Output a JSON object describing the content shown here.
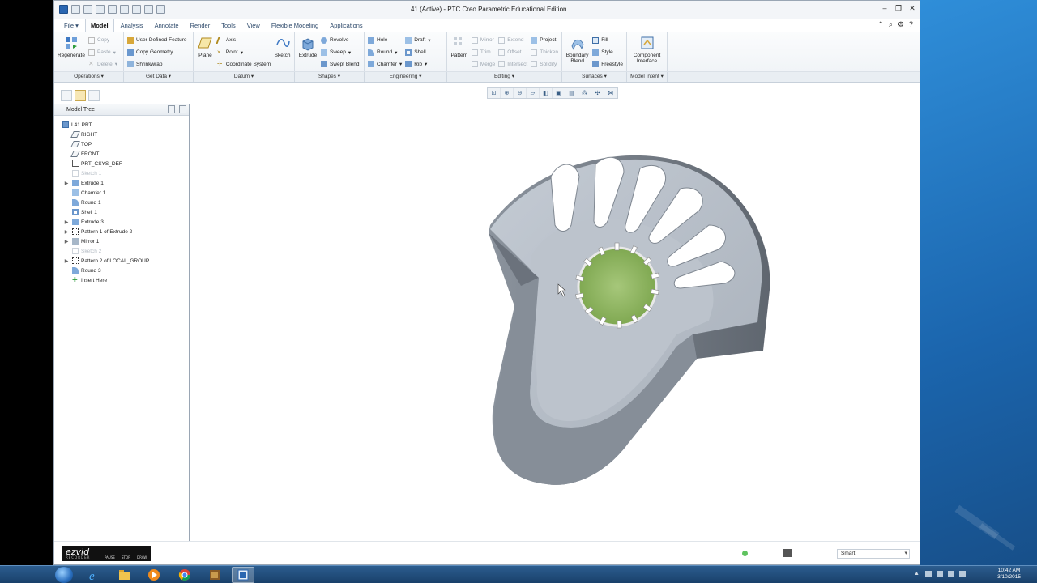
{
  "window": {
    "title": "L41 (Active) - PTC Creo Parametric Educational Edition"
  },
  "menu": {
    "tabs": [
      "File",
      "Model",
      "Analysis",
      "Annotate",
      "Render",
      "Tools",
      "View",
      "Flexible Modeling",
      "Applications"
    ],
    "active_tab": "Model"
  },
  "ribbon": {
    "operations": {
      "regenerate": "Regenerate",
      "copy": "Copy",
      "paste": "Paste",
      "delete": "Delete",
      "label": "Operations"
    },
    "get_data": {
      "udf": "User-Defined Feature",
      "copy_geometry": "Copy Geometry",
      "shrinkwrap": "Shrinkwrap",
      "label": "Get Data"
    },
    "datum": {
      "plane": "Plane",
      "axis": "Axis",
      "point": "Point",
      "csys": "Coordinate System",
      "sketch": "Sketch",
      "label": "Datum"
    },
    "shapes": {
      "extrude": "Extrude",
      "revolve": "Revolve",
      "sweep": "Sweep",
      "swept_blend": "Swept Blend",
      "label": "Shapes"
    },
    "engineering": {
      "hole": "Hole",
      "round": "Round",
      "chamfer": "Chamfer",
      "draft": "Draft",
      "shell": "Shell",
      "rib": "Rib",
      "label": "Engineering"
    },
    "editing": {
      "pattern": "Pattern",
      "mirror": "Mirror",
      "trim": "Trim",
      "merge": "Merge",
      "extend": "Extend",
      "offset": "Offset",
      "intersect": "Intersect",
      "project": "Project",
      "thicken": "Thicken",
      "solidify": "Solidify",
      "label": "Editing"
    },
    "surfaces": {
      "boundary_blend_1": "Boundary",
      "boundary_blend_2": "Blend",
      "fill": "Fill",
      "style": "Style",
      "freestyle": "Freestyle",
      "label": "Surfaces"
    },
    "model_intent": {
      "component_interface_1": "Component",
      "component_interface_2": "Interface",
      "label": "Model Intent"
    }
  },
  "model_tree": {
    "header": "Model Tree",
    "items": [
      {
        "label": "L41.PRT",
        "icon": "part-icon",
        "dim": false,
        "expand": false,
        "indent": 0
      },
      {
        "label": "RIGHT",
        "icon": "datum-plane-icon",
        "dim": false,
        "expand": false,
        "indent": 1
      },
      {
        "label": "TOP",
        "icon": "datum-plane-icon",
        "dim": false,
        "expand": false,
        "indent": 1
      },
      {
        "label": "FRONT",
        "icon": "datum-plane-icon",
        "dim": false,
        "expand": false,
        "indent": 1
      },
      {
        "label": "PRT_CSYS_DEF",
        "icon": "csys-icon",
        "dim": false,
        "expand": false,
        "indent": 1
      },
      {
        "label": "Sketch 1",
        "icon": "sketch-icon",
        "dim": true,
        "expand": false,
        "indent": 1
      },
      {
        "label": "Extrude 1",
        "icon": "extrude-icon",
        "dim": false,
        "expand": true,
        "indent": 1
      },
      {
        "label": "Chamfer 1",
        "icon": "chamfer-icon",
        "dim": false,
        "expand": false,
        "indent": 1
      },
      {
        "label": "Round 1",
        "icon": "round-icon",
        "dim": false,
        "expand": false,
        "indent": 1
      },
      {
        "label": "Shell 1",
        "icon": "shell-icon",
        "dim": false,
        "expand": false,
        "indent": 1
      },
      {
        "label": "Extrude 3",
        "icon": "extrude-icon",
        "dim": false,
        "expand": true,
        "indent": 1
      },
      {
        "label": "Pattern 1 of Extrude 2",
        "icon": "pattern-icon",
        "dim": false,
        "expand": true,
        "indent": 1
      },
      {
        "label": "Mirror 1",
        "icon": "mirror-icon",
        "dim": false,
        "expand": true,
        "indent": 1
      },
      {
        "label": "Sketch 2",
        "icon": "sketch-icon",
        "dim": true,
        "expand": false,
        "indent": 1
      },
      {
        "label": "Pattern 2 of LOCAL_GROUP",
        "icon": "pattern-icon",
        "dim": false,
        "expand": true,
        "indent": 1
      },
      {
        "label": "Round 3",
        "icon": "round-icon",
        "dim": false,
        "expand": false,
        "indent": 1
      },
      {
        "label": "Insert Here",
        "icon": "insert-here-icon",
        "dim": false,
        "expand": false,
        "indent": 1
      }
    ]
  },
  "status": {
    "filter": "Smart"
  },
  "ezvid": {
    "logo": "ezvid",
    "recorder": "RECORDER",
    "pause": "PAUSE",
    "stop": "STOP",
    "draw": "DRAW"
  },
  "tray": {
    "time": "10:42 AM",
    "date": "3/10/2015"
  },
  "colors": {
    "accent": "#2a66b1",
    "model_gray": "#a8b0ba",
    "highlight": "#8fbf5a"
  }
}
